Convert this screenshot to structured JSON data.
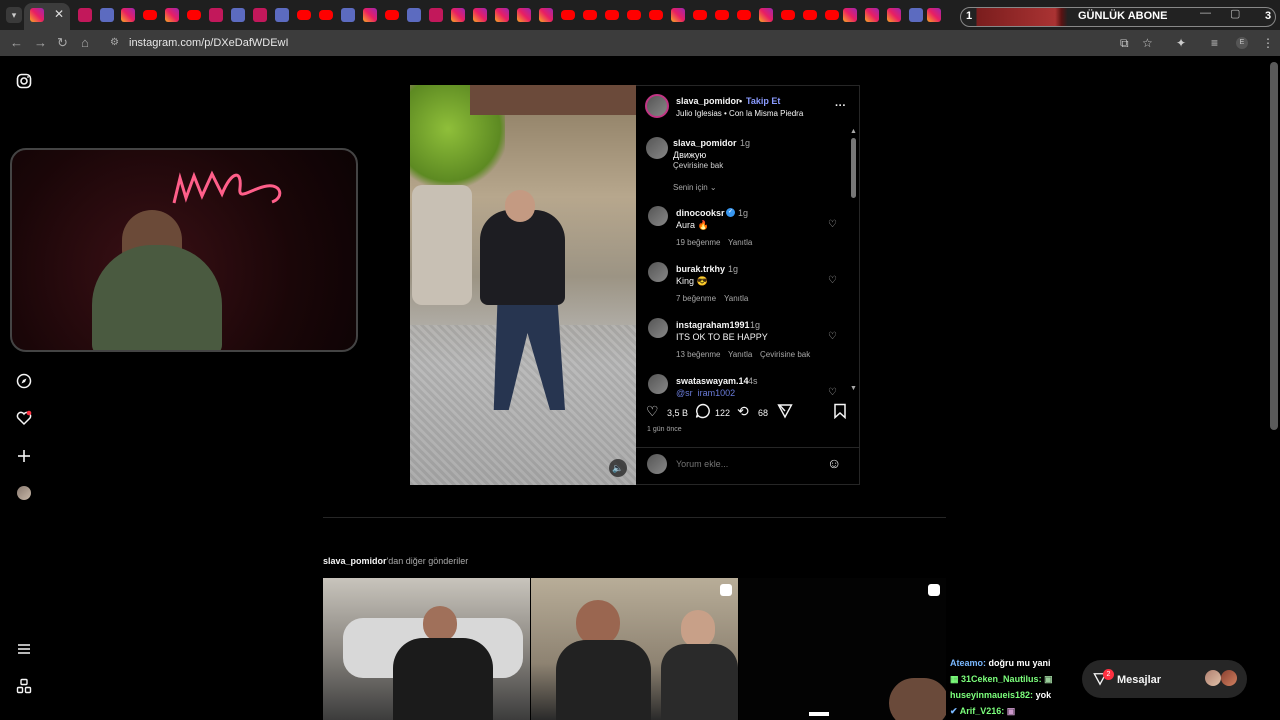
{
  "browser": {
    "url": "instagram.com/p/DXeDafWDEwI",
    "banner": {
      "left_number": "1",
      "title": "GÜNLÜK ABONE",
      "right_number": "3"
    }
  },
  "post": {
    "author": "slava_pomidor",
    "separator": "•",
    "follow_label": "Takip Et",
    "audio": "Julio Iglesias • Con la Misma Piedra",
    "caption": {
      "user": "slava_pomidor",
      "time": "1g",
      "text": "Движую",
      "translate": "Çevirisine bak",
      "for_you": "Senin için"
    },
    "comments": [
      {
        "user": "dinocooksr",
        "verified": true,
        "time": "1g",
        "text": "Aura 🔥",
        "likes": "19 beğenme",
        "reply": "Yanıtla",
        "translate": ""
      },
      {
        "user": "burak.trkhy",
        "verified": false,
        "time": "1g",
        "text": "King 😎",
        "likes": "7 beğenme",
        "reply": "Yanıtla",
        "translate": ""
      },
      {
        "user": "instagraham1991",
        "verified": false,
        "time": "1g",
        "text": "ITS OK TO BE HAPPY",
        "likes": "13 beğenme",
        "reply": "Yanıtla",
        "translate": "Çevirisine bak"
      },
      {
        "user": "swataswayam.14",
        "verified": false,
        "time": "4s",
        "text": "@sr_iram1002",
        "likes": "",
        "reply": "",
        "translate": ""
      }
    ],
    "like_count": "3,5 B",
    "comment_count": "122",
    "repost_count": "68",
    "posted": "1 gün önce",
    "comment_placeholder": "Yorum ekle..."
  },
  "more_posts": {
    "user": "slava_pomidor",
    "suffix": "'dan diğer gönderiler"
  },
  "chat": [
    {
      "user": "Ateamo:",
      "text": "doğru mu yani",
      "color": "#7ab8ff"
    },
    {
      "user": "31Ceken_Nautilus:",
      "text": "",
      "color": "#7cff7c"
    },
    {
      "user": "huseyinmaueis182:",
      "text": "yok",
      "color": "#7cff7c"
    },
    {
      "user": "Arif_V216:",
      "text": "",
      "color": "#7cff7c"
    }
  ],
  "messages": {
    "label": "Mesajlar",
    "badge": "2"
  },
  "icons": [
    "instagram-icon",
    "explore-icon",
    "heart-icon",
    "create-icon",
    "profile-icon",
    "menu-icon",
    "threads-icon"
  ],
  "colors": {
    "accent": "#8a9bff",
    "notification": "#ff3040"
  }
}
